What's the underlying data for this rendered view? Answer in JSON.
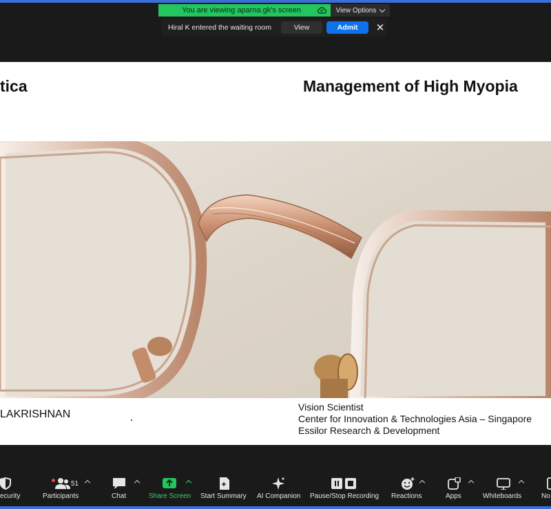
{
  "banner": {
    "viewing_text": "You are viewing aparna.gk's screen",
    "view_options_label": "View Options"
  },
  "notification": {
    "message": "Hiral K entered the waiting room",
    "view_label": "View",
    "admit_label": "Admit",
    "close_glyph": "✕"
  },
  "slide": {
    "left_title": "tica",
    "right_title": "Management of High Myopia",
    "speaker_name": "LAKRISHNAN",
    "speaker_info": [
      "Vision Scientist",
      "Center for Innovation & Technologies Asia – Singapore",
      "Essilor Research & Development"
    ]
  },
  "toolbar": {
    "security": "ecurity",
    "participants": "Participants",
    "participants_count": "51",
    "chat": "Chat",
    "share_screen": "Share Screen",
    "start_summary": "Start Summary",
    "ai_companion": "AI Companion",
    "pause_stop_recording": "Pause/Stop Recording",
    "reactions": "Reactions",
    "apps": "Apps",
    "whiteboards": "Whiteboards",
    "notes": "No"
  },
  "colors": {
    "share_green": "#22c55e",
    "admit_blue": "#0e72ed",
    "frame_border": "#3a6fd8"
  }
}
